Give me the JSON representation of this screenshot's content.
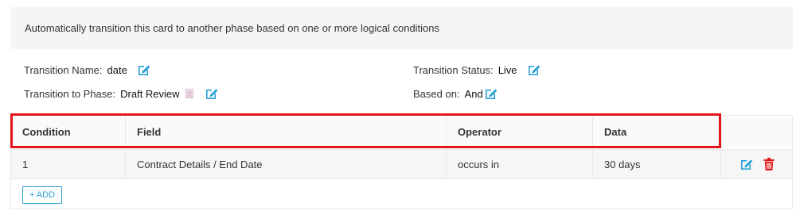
{
  "banner": {
    "text": "Automatically transition this card to another phase based on one or more logical conditions"
  },
  "properties": {
    "transition_name_label": "Transition Name:",
    "transition_name_value": "date",
    "transition_phase_label": "Transition to Phase:",
    "transition_phase_value": "Draft Review",
    "transition_status_label": "Transition Status:",
    "transition_status_value": "Live",
    "based_on_label": "Based on:",
    "based_on_value": "And"
  },
  "table": {
    "headers": [
      "Condition",
      "Field",
      "Operator",
      "Data"
    ],
    "rows": [
      {
        "condition": "1",
        "field": "Contract Details / End Date",
        "operator": "occurs in",
        "data": "30 days"
      }
    ],
    "add_label": "+ ADD"
  },
  "colors": {
    "accent": "#2aa0d6",
    "delete": "#e3151a",
    "highlight": "#e3151a"
  },
  "icons": {
    "edit": "edit-icon",
    "document": "document-icon",
    "delete": "trash-icon"
  }
}
